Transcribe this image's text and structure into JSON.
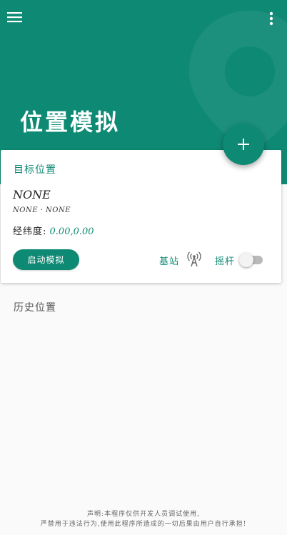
{
  "header": {
    "title": "位置模拟",
    "menu_icon": "hamburger-menu-icon",
    "more_icon": "more-vert-icon",
    "background_color": "#0e8a74"
  },
  "fab": {
    "icon": "plus-icon"
  },
  "target_card": {
    "title": "目标位置",
    "location_name": "NONE",
    "location_detail": "NONE · NONE",
    "coords_label": "经纬度:",
    "coords_value": "0.00,0.00",
    "start_button": "启动模拟",
    "base_station_label": "基站",
    "base_station_icon": "antenna-icon",
    "joystick_label": "摇杆",
    "joystick_enabled": false
  },
  "history": {
    "label": "历史位置"
  },
  "footer": {
    "line1": "声明:本程序仅供开发人员调试使用,",
    "line2": "严禁用于违法行为,使用此程序所造成的一切后果由用户自行承担!"
  }
}
